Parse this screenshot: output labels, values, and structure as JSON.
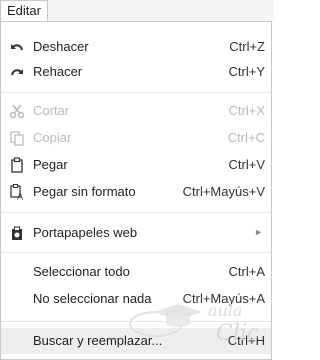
{
  "menu": {
    "title": "Editar",
    "items": [
      {
        "label": "Deshacer",
        "shortcut": "Ctrl+Z",
        "icon": "undo-icon",
        "enabled": true
      },
      {
        "label": "Rehacer",
        "shortcut": "Ctrl+Y",
        "icon": "redo-icon",
        "enabled": true
      },
      {
        "label": "Cortar",
        "shortcut": "Ctrl+X",
        "icon": "cut-icon",
        "enabled": false
      },
      {
        "label": "Copiar",
        "shortcut": "Ctrl+C",
        "icon": "copy-icon",
        "enabled": false
      },
      {
        "label": "Pegar",
        "shortcut": "Ctrl+V",
        "icon": "paste-icon",
        "enabled": true
      },
      {
        "label": "Pegar sin formato",
        "shortcut": "Ctrl+Mayús+V",
        "icon": "paste-plain-icon",
        "enabled": true
      },
      {
        "label": "Portapapeles web",
        "shortcut": "",
        "icon": "web-clipboard-icon",
        "enabled": true,
        "submenu": true
      },
      {
        "label": "Seleccionar todo",
        "shortcut": "Ctrl+A",
        "enabled": true
      },
      {
        "label": "No seleccionar nada",
        "shortcut": "Ctrl+Mayús+A",
        "enabled": true
      },
      {
        "label": "Buscar y reemplazar...",
        "shortcut": "Ctrl+H",
        "enabled": true,
        "highlighted": true
      }
    ]
  },
  "watermark": {
    "text_top": "aula",
    "text_bottom": "Clic"
  },
  "colors": {
    "disabled": "#b9b9b9",
    "hover": "#eeeeee",
    "separator": "#e6e6e6",
    "watermark": "#d9d9d9"
  }
}
